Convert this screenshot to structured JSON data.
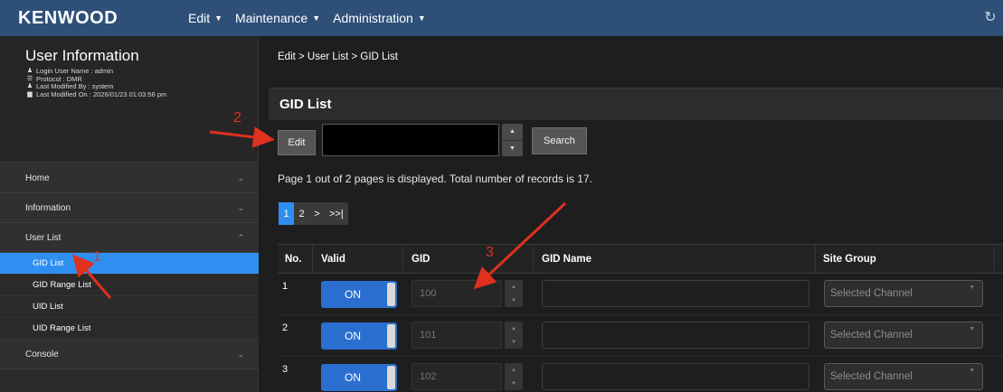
{
  "header": {
    "logo": "KENWOOD",
    "menus": [
      {
        "label": "Edit"
      },
      {
        "label": "Maintenance"
      },
      {
        "label": "Administration"
      }
    ]
  },
  "user_info": {
    "title": "User Information",
    "lines": [
      {
        "icon": "user-icon",
        "text": "Login User Name : admin"
      },
      {
        "icon": "list-icon",
        "text": "Protocol : DMR"
      },
      {
        "icon": "user-icon",
        "text": "Last Modified By : system"
      },
      {
        "icon": "calendar-icon",
        "text": "Last Modified On : 2026/01/23 01:03:56 pm"
      }
    ]
  },
  "sidebar": {
    "items": [
      {
        "label": "Home"
      },
      {
        "label": "Information"
      },
      {
        "label": "User List"
      }
    ],
    "subitems": [
      {
        "label": "GID List",
        "active": true
      },
      {
        "label": "GID Range List"
      },
      {
        "label": "UID List"
      },
      {
        "label": "UID Range List"
      }
    ],
    "console": {
      "label": "Console"
    }
  },
  "main": {
    "breadcrumb": "Edit  > User List > GID List",
    "title": "GID List",
    "edit_label": "Edit",
    "search_label": "Search",
    "search_value": "",
    "page_info": "Page 1 out of 2 pages is displayed. Total number of records is 17.",
    "pager": [
      "1",
      "2",
      ">",
      ">>|"
    ],
    "columns": [
      "No.",
      "Valid",
      "GID",
      "GID Name",
      "Site Group"
    ],
    "rows": [
      {
        "no": "1",
        "valid": "ON",
        "gid": "100",
        "name": "",
        "site": "Selected Channel"
      },
      {
        "no": "2",
        "valid": "ON",
        "gid": "101",
        "name": "",
        "site": "Selected Channel"
      },
      {
        "no": "3",
        "valid": "ON",
        "gid": "102",
        "name": "",
        "site": "Selected Channel"
      }
    ]
  },
  "annotations": {
    "n1": "1",
    "n2": "2",
    "n3": "3",
    "color": "#e0301e"
  },
  "colors": {
    "topbar": "#2d4f78",
    "accent": "#2f8ff1",
    "toggle": "#2a6fcf"
  }
}
